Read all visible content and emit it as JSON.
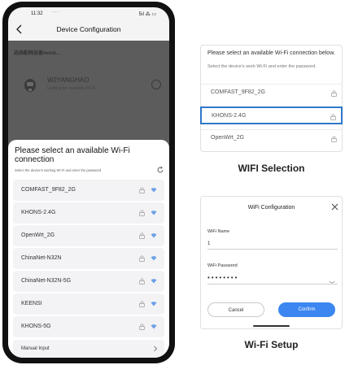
{
  "phone": {
    "status": {
      "time": "11:32",
      "dots": "···",
      "icons": "5ıl ⁂ ▭"
    },
    "nav": {
      "title": "Device Configuration"
    },
    "dimmed": {
      "header": "选择配网设备twork...",
      "device_name": "W2YANGHAO",
      "device_sub": "Looking for available Wi-Fi..."
    },
    "sheet": {
      "title": "Please select an available Wi-Fi connection",
      "subtitle": "Select the device's working Wi-Fi and enter the password",
      "networks": [
        {
          "name": "COMFAST_9F82_2G"
        },
        {
          "name": "KHONS-2.4G"
        },
        {
          "name": "OpenWrt_2G"
        },
        {
          "name": "ChinaNet-N32N"
        },
        {
          "name": "ChinaNet-N32N-5G"
        },
        {
          "name": "KEENSI"
        },
        {
          "name": "KHONS-5G"
        }
      ],
      "manual_input": "Manual Input"
    }
  },
  "selection_card": {
    "title": "Please select an available Wi-Fi connection below.",
    "subtitle": "Select the device's work Wi-Fi and enter the password.",
    "networks": [
      {
        "name": "COMFAST_9F82_2G",
        "selected": false
      },
      {
        "name": "KHONS-2.4G",
        "selected": true
      },
      {
        "name": "OpenWrt_2G",
        "selected": false
      }
    ],
    "caption": "WIFI Selection"
  },
  "config_card": {
    "title": "WiFi Configuration",
    "name_label": "WiFi Name",
    "name_value": "1",
    "password_label": "WiFi Password",
    "password_value": "••••••••",
    "cancel_label": "Cancel",
    "confirm_label": "Confirm",
    "caption": "Wi-Fi Setup"
  },
  "colors": {
    "accent": "#3b86f0",
    "selected_border": "#2f77c8",
    "overlay": "#5c5c5c"
  },
  "icons": [
    "back-icon",
    "device-icon",
    "refresh-icon",
    "lock-icon",
    "wifi-icon",
    "chevron-right-icon",
    "close-icon",
    "eye-icon"
  ]
}
